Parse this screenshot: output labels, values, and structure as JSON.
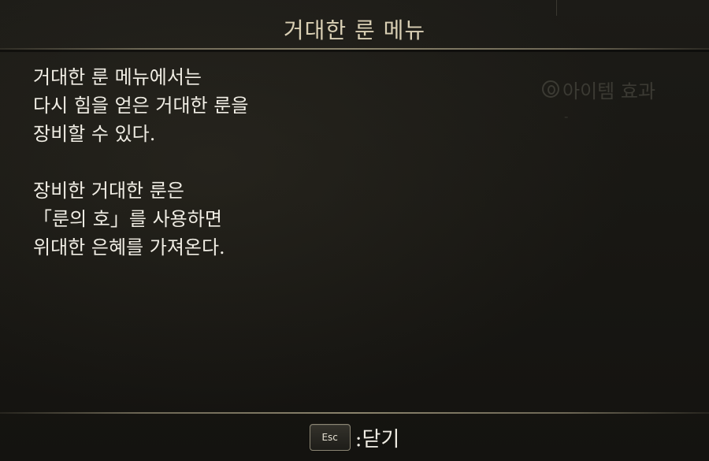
{
  "title": "거대한 룬 메뉴",
  "body": {
    "paragraph1": [
      "거대한 룬 메뉴에서는",
      "다시 힘을 얻은 거대한 룬을",
      "장비할 수 있다."
    ],
    "paragraph2": [
      "장비한 거대한 룬은",
      "「룬의 호」를 사용하면",
      "위대한 은혜를 가져온다."
    ]
  },
  "background": {
    "item_effect_label": "아이템 효과",
    "item_effect_icon": "rune-circle-icon",
    "dash": "-"
  },
  "footer": {
    "key_label": "Esc",
    "action_label": ":닫기"
  },
  "colors": {
    "background": "#181713",
    "title_text": "#d9cfb4",
    "body_text": "#f0ede4",
    "divider": "#8a836c"
  }
}
